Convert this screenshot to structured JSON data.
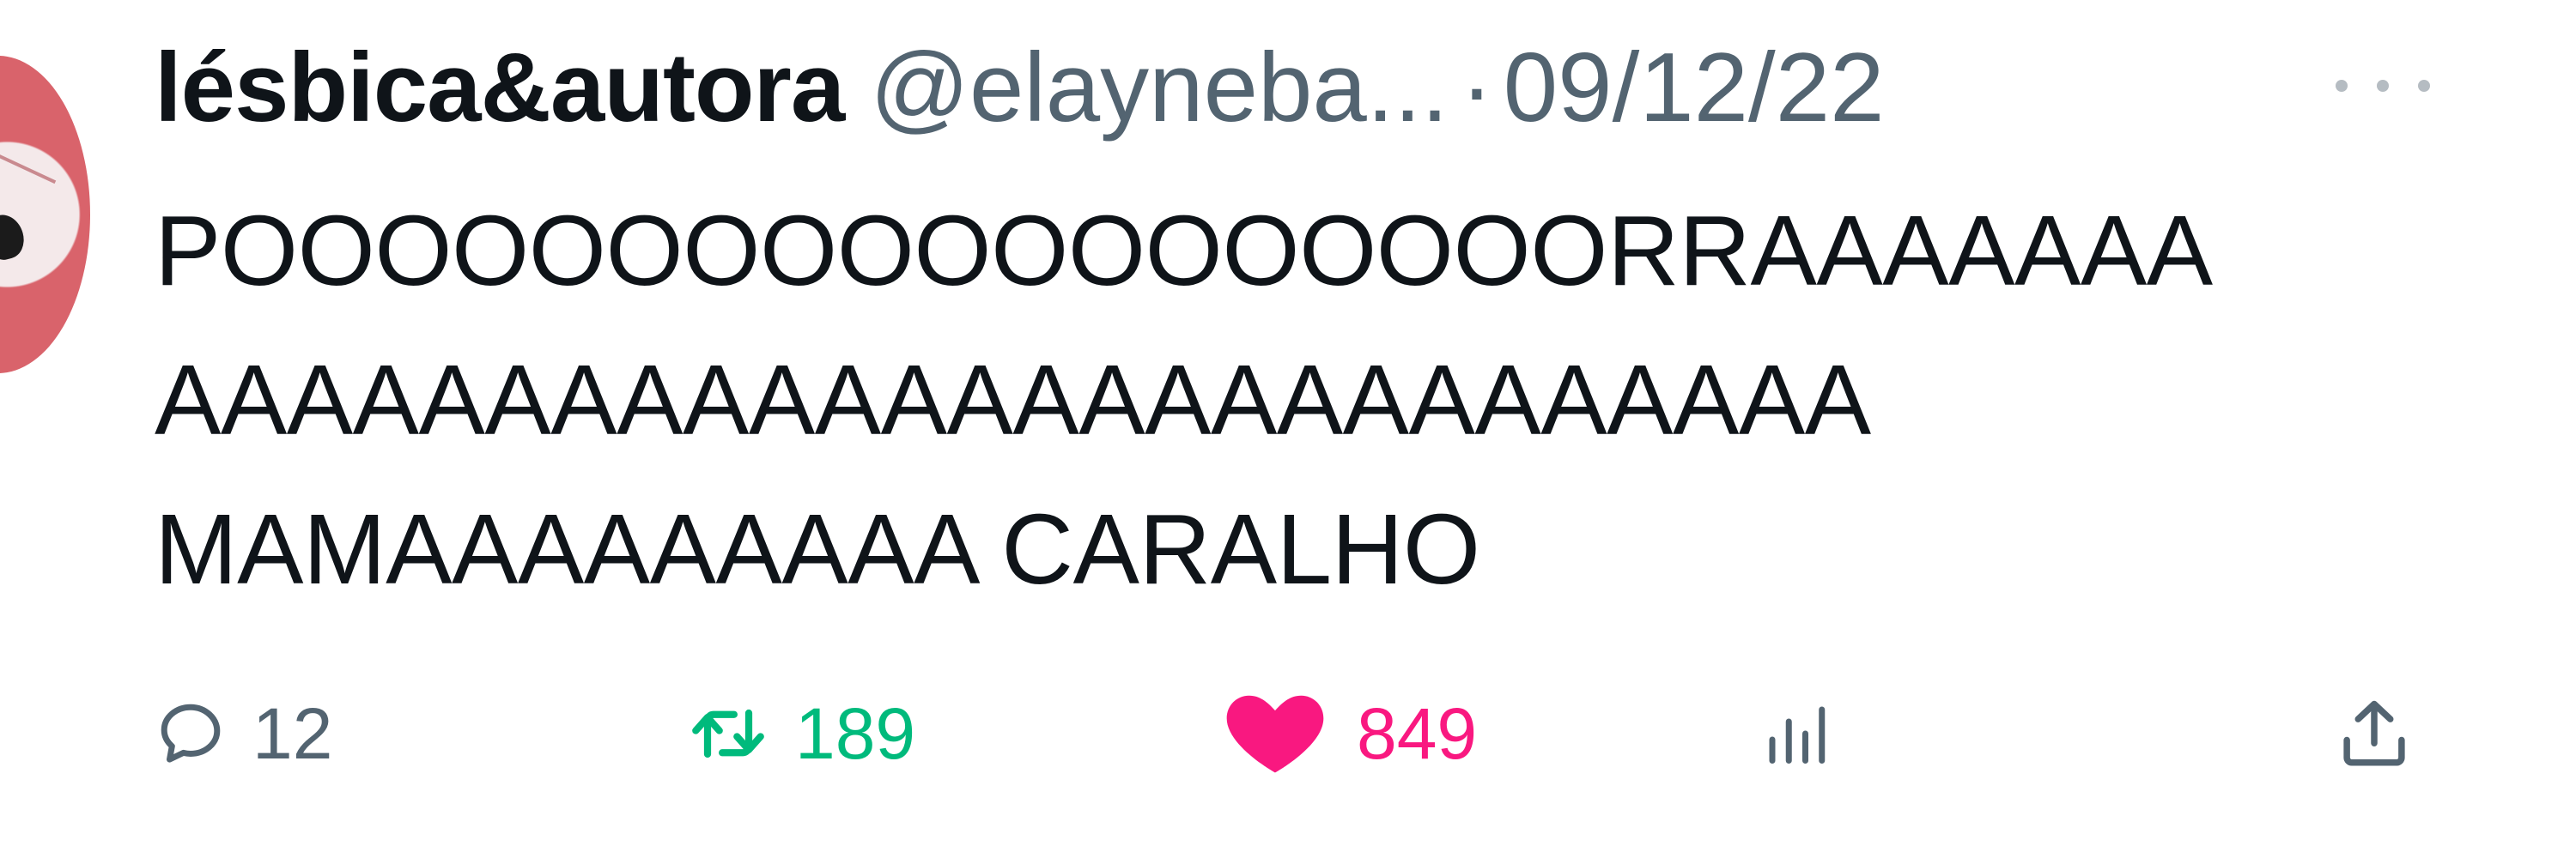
{
  "tweet": {
    "display_name": "lésbica&autora",
    "handle": "@elayneba...",
    "separator": "·",
    "date": "09/12/22",
    "text_lines": [
      "POOOOOOOOOOOOOOOOOORRAAAAAAA",
      "AAAAAAAAAAAAAAAAAAAAAAAAAA",
      "MAMAAAAAAAAA CARALHO"
    ],
    "actions": {
      "replies": "12",
      "retweets": "189",
      "likes": "849"
    }
  },
  "colors": {
    "text_primary": "#0f1419",
    "text_secondary": "#536471",
    "retweet_active": "#00ba7c",
    "like_active": "#f91880",
    "avatar_accent": "#d9636b"
  },
  "icons": {
    "reply": "speech-bubble-icon",
    "retweet": "retweet-arrows-icon",
    "like": "heart-filled-icon",
    "views": "bar-chart-icon",
    "share": "share-upload-icon",
    "more": "ellipsis-icon"
  }
}
